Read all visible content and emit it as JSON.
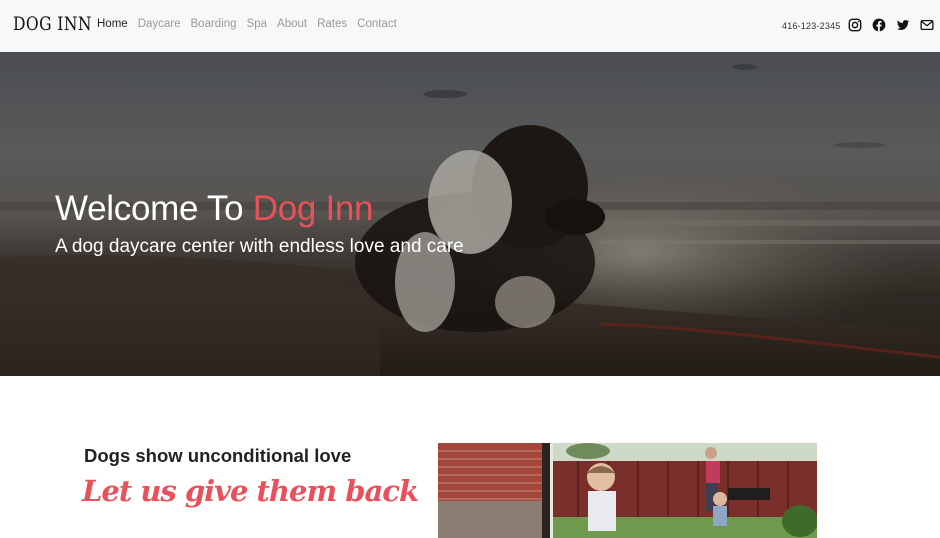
{
  "brand": {
    "name": "DOG INN"
  },
  "nav": {
    "items": [
      {
        "label": "Home",
        "active": true
      },
      {
        "label": "Daycare",
        "active": false
      },
      {
        "label": "Boarding",
        "active": false
      },
      {
        "label": "Spa",
        "active": false
      },
      {
        "label": "About",
        "active": false
      },
      {
        "label": "Rates",
        "active": false
      },
      {
        "label": "Contact",
        "active": false
      }
    ],
    "phone": "416-123-2345",
    "social": [
      "instagram-icon",
      "facebook-icon",
      "twitter-icon",
      "mail-icon"
    ]
  },
  "hero": {
    "title_prefix": "Welcome To ",
    "title_accent": "Dog Inn",
    "subtitle": "A dog daycare center with endless love and care"
  },
  "intro": {
    "heading": "Dogs show unconditional love",
    "script": "Let us give them back"
  },
  "colors": {
    "accent": "#e8505b",
    "navbar_bg": "#f7f8fa"
  }
}
